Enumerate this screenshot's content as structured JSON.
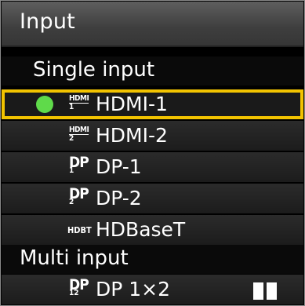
{
  "title": "Input",
  "single_section": "Single input",
  "multi_section": "Multi input",
  "items": [
    {
      "label": "HDMI-1",
      "icon": "hdmi-icon",
      "icon_top": "HDMI",
      "icon_num": "1",
      "selected": true,
      "active": true
    },
    {
      "label": "HDMI-2",
      "icon": "hdmi-icon",
      "icon_top": "HDMI",
      "icon_num": "2"
    },
    {
      "label": "DP-1",
      "icon": "dp-icon",
      "icon_top": "DP",
      "icon_num": "1"
    },
    {
      "label": "DP-2",
      "icon": "dp-icon",
      "icon_top": "DP",
      "icon_num": "2"
    },
    {
      "label": "HDBaseT",
      "icon": "hdbt-icon",
      "icon_top": "HDBT"
    }
  ],
  "multi_items": [
    {
      "label": "DP 1×2",
      "icon": "dp-icon",
      "icon_top": "DP",
      "icon_num": "12",
      "layout_icon": "split-screen-icon"
    }
  ],
  "colors": {
    "selection": "#f2c300",
    "active_dot": "#5fda4a"
  }
}
